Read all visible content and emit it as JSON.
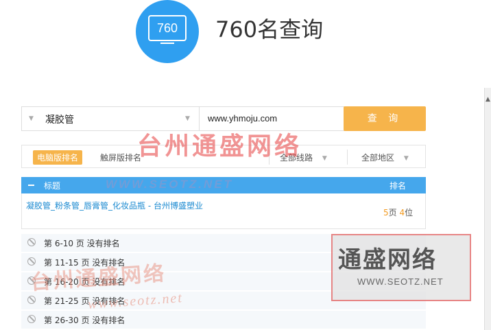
{
  "header": {
    "logo_text": "760",
    "title": "760名查询"
  },
  "search": {
    "keyword": "凝胶管",
    "domain": "www.yhmoju.com",
    "query_button": "查 询"
  },
  "filters": {
    "tab_pc": "电脑版排名",
    "tab_mobile": "触屏版排名",
    "line_select": "全部线路",
    "region_select": "全部地区"
  },
  "table": {
    "header_title": "标题",
    "header_rank": "排名",
    "result": {
      "title": "凝胶管_粉条管_唇膏管_化妆品瓶 - 台州博盛塑业",
      "page": "5",
      "page_suffix": "页 ",
      "position": "4",
      "position_suffix": "位"
    },
    "no_rank_rows": [
      "第 6-10 页 没有排名",
      "第 11-15 页 没有排名",
      "第 16-20 页 没有排名",
      "第 21-25 页 没有排名",
      "第 26-30 页 没有排名"
    ]
  },
  "watermarks": {
    "top_text": "台州通盛网络",
    "top_url": "WWW.SEOTZ.NET",
    "box_title": "通盛网络",
    "box_url": "WWW.SEOTZ.NET",
    "bottom_text": "台州通盛网络",
    "bottom_url": "www.seotz.net"
  }
}
